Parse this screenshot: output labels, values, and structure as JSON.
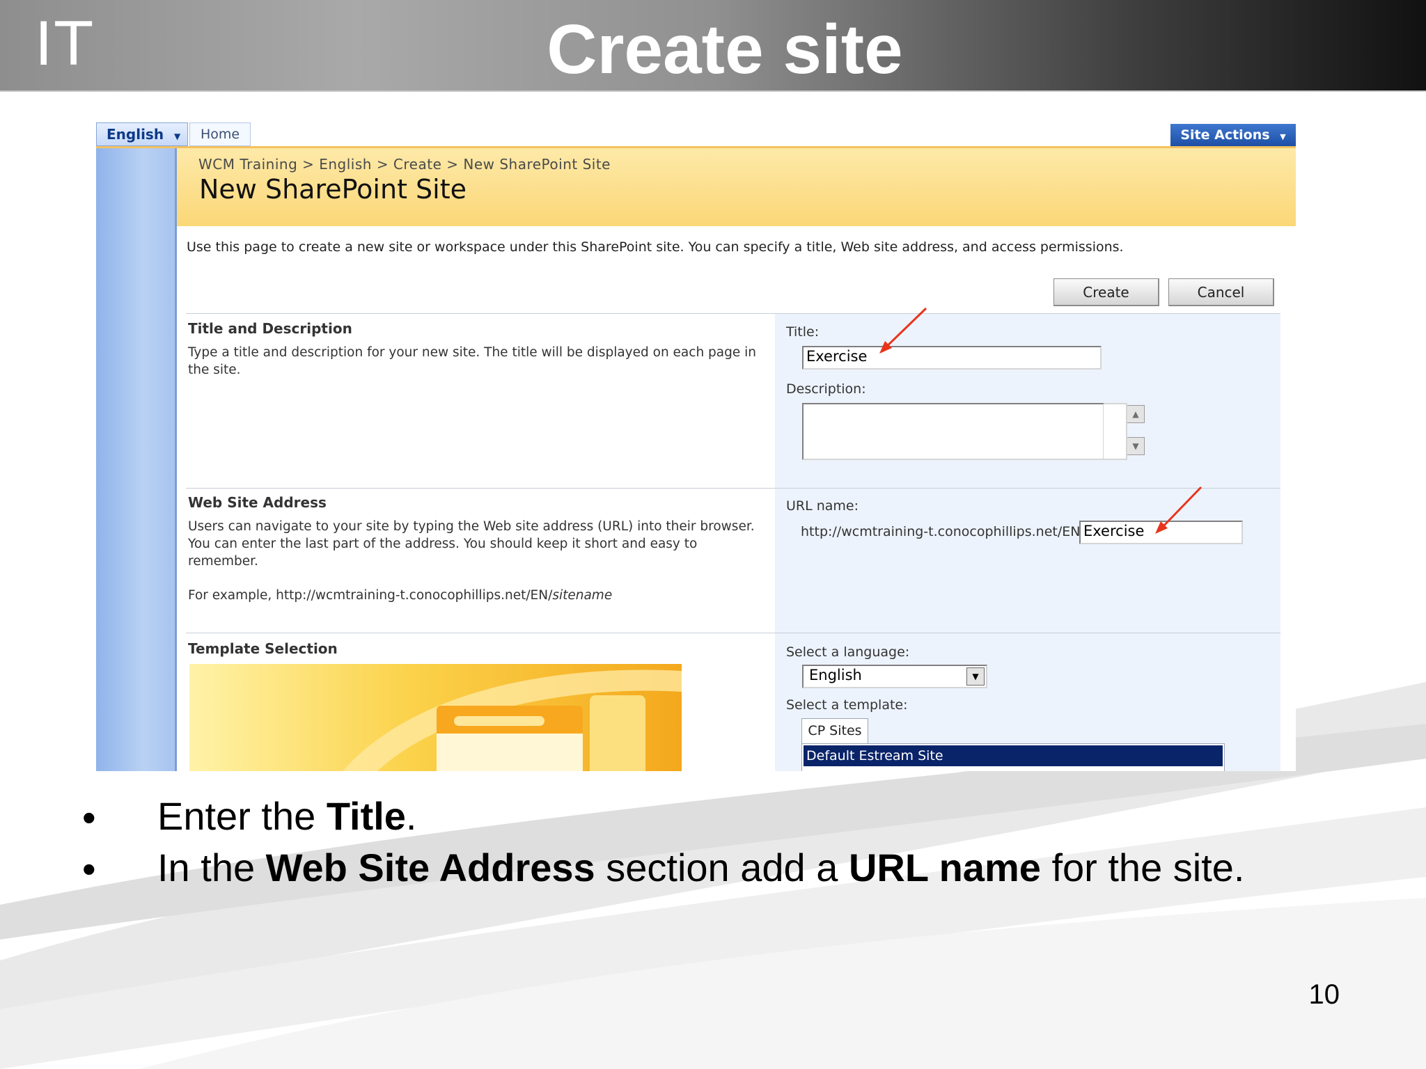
{
  "header": {
    "brand": "IT",
    "title": "Create site"
  },
  "screenshot": {
    "top_nav": {
      "language_tab": "English",
      "home_tab": "Home",
      "site_actions": "Site Actions"
    },
    "breadcrumb": "WCM Training > English > Create > New SharePoint Site",
    "page_title": "New SharePoint Site",
    "intro_text": "Use this page to create a new site or workspace under this SharePoint site. You can specify a title, Web site address, and access permissions.",
    "buttons": {
      "create": "Create",
      "cancel": "Cancel"
    },
    "title_section": {
      "heading": "Title and Description",
      "description": "Type a title and description for your new site. The title will be displayed on each page in the site.",
      "title_label": "Title:",
      "title_value": "Exercise",
      "description_label": "Description:",
      "description_value": ""
    },
    "address_section": {
      "heading": "Web Site Address",
      "description": "Users can navigate to your site by typing the Web site address (URL) into their browser. You can enter the last part of the address. You should keep it short and easy to remember.",
      "example_prefix": "For example, http://wcmtraining-t.conocophillips.net/EN/",
      "example_sitename": "sitename",
      "url_label": "URL name:",
      "url_prefix": "http://wcmtraining-t.conocophillips.net/EN/",
      "url_value": "Exercise"
    },
    "template_section": {
      "heading": "Template Selection",
      "language_label": "Select a language:",
      "language_value": "English",
      "template_label": "Select a template:",
      "template_tab": "CP Sites",
      "template_selected": "Default Estream Site"
    }
  },
  "bullets": [
    {
      "pre": "Enter the ",
      "bold1": "Title",
      "mid": ".",
      "bold2": "",
      "post": ""
    },
    {
      "pre": "In the ",
      "bold1": "Web Site Address",
      "mid": " section add a ",
      "bold2": "URL name",
      "post": " for the site."
    }
  ],
  "bullet_symbol": "•",
  "page_number": "10",
  "colors": {
    "title_band": "#fbd777",
    "accent_blue": "#1d4fa5",
    "selection": "#0a246a",
    "annotation_arrow": "#e8341c"
  }
}
